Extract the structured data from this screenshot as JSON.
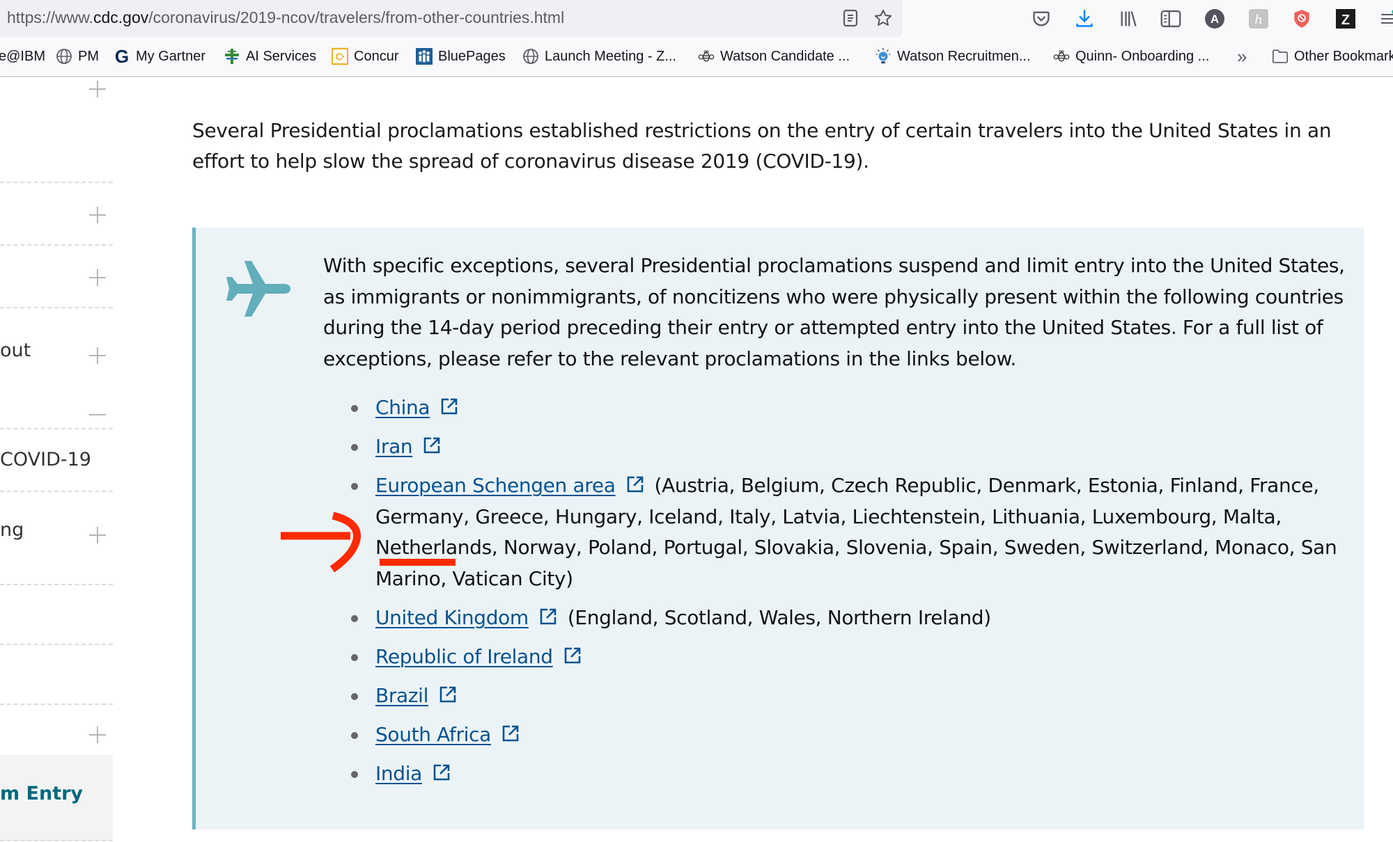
{
  "browser": {
    "url_prefix": "https://www.",
    "url_domain": "cdc.gov",
    "url_path": "/coronavirus/2019-ncov/travelers/from-other-countries.html",
    "url_icons": [
      "reader-view-icon",
      "bookmark-star-icon"
    ],
    "toolbar_icons": [
      "pocket-icon",
      "downloads-icon",
      "library-icon",
      "sidebar-icon",
      "account-a-icon",
      "honey-extension-icon",
      "adblock-shield-icon",
      "zotero-z-icon",
      "menu-hamburger-icon"
    ],
    "accent_color": "#0a84ff"
  },
  "bookmarks": [
    {
      "label": "e@IBM",
      "icon": "none"
    },
    {
      "label": "PM",
      "icon": "globe-icon"
    },
    {
      "label": "My Gartner",
      "icon": "gartner-g-icon"
    },
    {
      "label": "AI Services",
      "icon": "ai-services-icon"
    },
    {
      "label": "Concur",
      "icon": "concur-icon"
    },
    {
      "label": "BluePages",
      "icon": "bluepages-icon"
    },
    {
      "label": "Launch Meeting - Z...",
      "icon": "globe-icon"
    },
    {
      "label": "Watson Candidate ...",
      "icon": "bee-icon"
    },
    {
      "label": "Watson Recruitmen...",
      "icon": "lightbulb-icon"
    },
    {
      "label": "Quinn- Onboarding ...",
      "icon": "bee-icon"
    },
    {
      "label": "Other Bookmarks",
      "icon": "folder-icon"
    }
  ],
  "bookmarks_overflow": "»",
  "sidebar": {
    "items": [
      {
        "label": "",
        "toggle": "+"
      },
      {
        "label": "",
        "toggle": "+"
      },
      {
        "label": "",
        "toggle": "+"
      },
      {
        "label": "out",
        "toggle": "+"
      },
      {
        "label": "",
        "toggle": "−"
      },
      {
        "label": "COVID-19",
        "toggle": ""
      },
      {
        "label": "ng",
        "toggle": "+"
      },
      {
        "label": "",
        "toggle": ""
      },
      {
        "label": "",
        "toggle": ""
      },
      {
        "label": "",
        "toggle": ""
      },
      {
        "label": "",
        "toggle": "+"
      }
    ],
    "active_item": "m Entry"
  },
  "main": {
    "intro": "Several Presidential proclamations established restrictions on the entry of certain travelers into the United States in an effort to help slow the spread of coronavirus disease 2019 (COVID-19).",
    "callout": {
      "icon": "airplane-icon",
      "text": "With specific exceptions, several Presidential proclamations suspend and limit entry into the United States, as immigrants or nonimmigrants, of noncitizens who were physically present within the following countries during the 14-day period preceding their entry or attempted entry into the United States. For a full list of exceptions, please refer to the relevant proclamations in the links below.",
      "countries": [
        {
          "name": "China",
          "note": ""
        },
        {
          "name": "Iran",
          "note": ""
        },
        {
          "name": "European Schengen area",
          "note": "(Austria, Belgium, Czech Republic, Denmark, Estonia, Finland, France, Germany, Greece, Hungary, Iceland, Italy, Latvia, Liechtenstein, Lithuania, Luxembourg, Malta, Netherlands, Norway, Poland, Portugal, Slovakia, Slovenia, Spain, Sweden, Switzerland, Monaco, San Marino, Vatican City)"
        },
        {
          "name": "United Kingdom",
          "note": "(England, Scotland, Wales, Northern Ireland)"
        },
        {
          "name": "Republic of Ireland",
          "note": ""
        },
        {
          "name": "Brazil",
          "note": ""
        },
        {
          "name": "South Africa",
          "note": ""
        },
        {
          "name": "India",
          "note": ""
        }
      ]
    }
  },
  "annotation": {
    "type": "red-arrow-and-underline",
    "target_text": "Netherlands",
    "color": "#ff2a00"
  },
  "colors": {
    "link": "#075290",
    "callout_bg": "#ebf3f7",
    "callout_border": "#6bb3c0",
    "sidebar_active_text": "#00697c"
  }
}
